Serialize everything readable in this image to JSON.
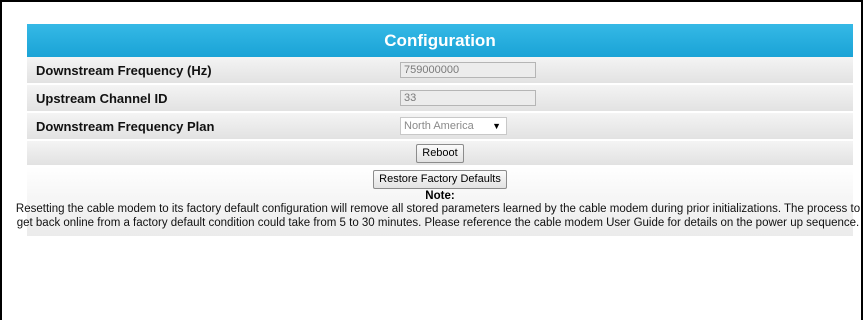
{
  "config": {
    "title": "Configuration",
    "rows": [
      {
        "label": "Downstream Frequency (Hz)",
        "value": "759000000"
      },
      {
        "label": "Upstream Channel ID",
        "value": "33"
      },
      {
        "label": "Downstream Frequency Plan",
        "value": "North America"
      }
    ],
    "reboot_label": "Reboot",
    "restore_label": "Restore Factory Defaults",
    "note_title": "Note:",
    "note_text": "Resetting the cable modem to its factory default configuration will remove all stored parameters learned by the cable modem during prior initializations. The process to get back online from a factory default condition could take from 5 to 30 minutes. Please reference the cable modem User Guide for details on the power up sequence."
  },
  "icons": {
    "select_arrow": "triangle-down-icon"
  },
  "colors": {
    "header": "#1aa3d6"
  }
}
